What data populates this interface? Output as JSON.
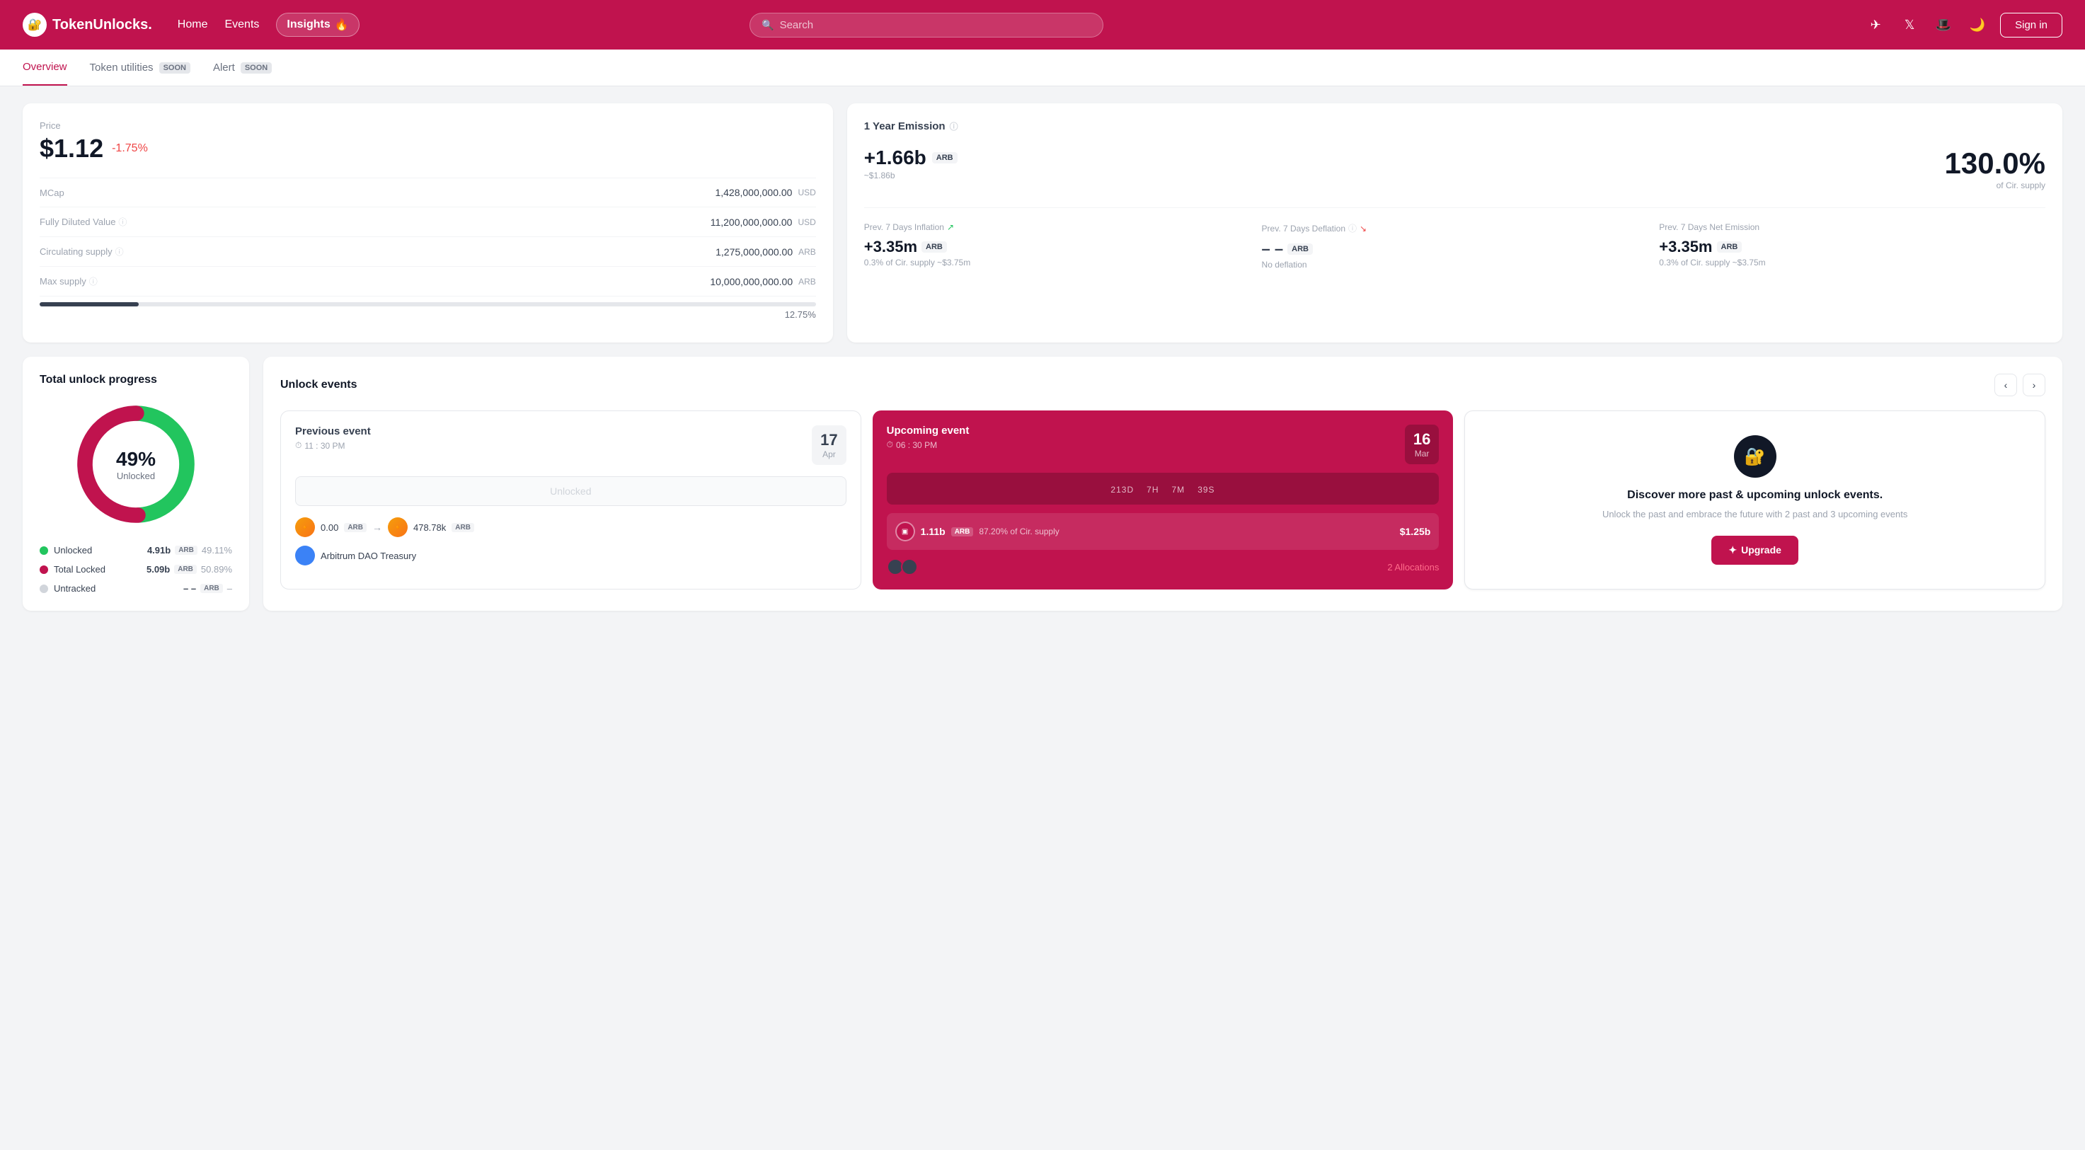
{
  "nav": {
    "logo_text": "TokenUnlocks.",
    "logo_icon": "🔐",
    "links": [
      "Home",
      "Events"
    ],
    "insights_label": "Insights",
    "insights_emoji": "🔥",
    "search_placeholder": "Search",
    "sign_in_label": "Sign in"
  },
  "tabs": [
    {
      "label": "Overview",
      "active": true,
      "soon": false
    },
    {
      "label": "Token utilities",
      "active": false,
      "soon": true
    },
    {
      "label": "Alert",
      "active": false,
      "soon": true
    }
  ],
  "price_card": {
    "label": "Price",
    "value": "$1.12",
    "change": "-1.75%",
    "stats": [
      {
        "label": "MCap",
        "value": "1,428,000,000.00",
        "unit": "USD"
      },
      {
        "label": "Fully Diluted Value",
        "value": "11,200,000,000.00",
        "unit": "USD",
        "info": true
      },
      {
        "label": "Circulating supply",
        "value": "1,275,000,000.00",
        "unit": "ARB",
        "info": true
      },
      {
        "label": "Max supply",
        "value": "10,000,000,000.00",
        "unit": "ARB",
        "info": true
      }
    ],
    "progress_pct": "12.75%",
    "progress_fill_width": "12.75"
  },
  "emission_card": {
    "title": "1 Year Emission",
    "amount": "+1.66b",
    "token": "ARB",
    "sub_amount": "~$1.86b",
    "pct": "130.0%",
    "pct_sub": "of Cir. supply",
    "metrics": [
      {
        "label": "Prev. 7 Days Inflation",
        "icon_dir": "up",
        "value": "+3.35m",
        "token": "ARB",
        "sub": "0.3% of Cir. supply ~$3.75m"
      },
      {
        "label": "Prev. 7 Days Deflation",
        "icon_dir": "down",
        "value": "– –",
        "token": "ARB",
        "sub": "No deflation",
        "info": true
      },
      {
        "label": "Prev. 7 Days Net Emission",
        "icon_dir": null,
        "value": "+3.35m",
        "token": "ARB",
        "sub": "0.3% of Cir. supply ~$3.75m"
      }
    ]
  },
  "unlock_progress": {
    "title": "Total unlock progress",
    "pct": "49%",
    "pct_label": "Unlocked",
    "legend": [
      {
        "name": "Unlocked",
        "color": "#22c55e",
        "amount": "4.91b",
        "token": "ARB",
        "pct": "49.11%"
      },
      {
        "name": "Total Locked",
        "color": "#c0134e",
        "amount": "5.09b",
        "token": "ARB",
        "pct": "50.89%"
      },
      {
        "name": "Untracked",
        "color": "#d1d5db",
        "amount": "–  –",
        "token": "ARB",
        "pct": "–"
      }
    ]
  },
  "unlock_events": {
    "title": "Unlock events",
    "previous": {
      "label": "Previous event",
      "time": "11 : 30 PM",
      "date_day": "17",
      "date_month": "Apr",
      "unlocked_label": "Unlocked",
      "from_amount": "0.00",
      "from_token": "ARB",
      "to_amount": "478.78k",
      "to_token": "ARB",
      "dao_name": "Arbitrum DAO Treasury"
    },
    "upcoming": {
      "label": "Upcoming event",
      "time": "06 : 30 PM",
      "date_day": "16",
      "date_month": "Mar",
      "countdown_days": "213",
      "countdown_hours": "7",
      "countdown_minutes": "7M",
      "countdown_seconds": "39",
      "amount": "1.11b",
      "token": "ARB",
      "pct": "87.20% of Cir. supply",
      "usd": "$1.25b",
      "allocations_count": "2 Allocations"
    },
    "discover": {
      "title": "Discover more\npast & upcoming unlock events.",
      "sub": "Unlock the past and embrace the future with 2 past and 3 upcoming events",
      "upgrade_label": "Upgrade"
    }
  }
}
